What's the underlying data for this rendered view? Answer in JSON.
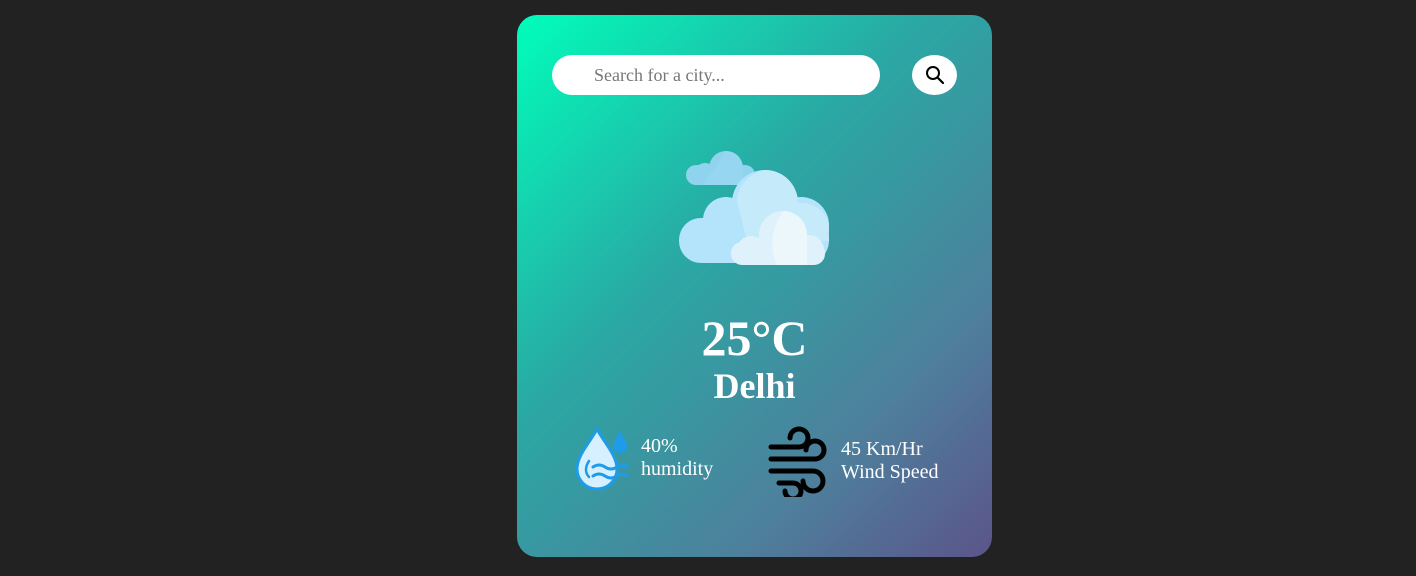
{
  "search": {
    "placeholder": "Search for a city...",
    "button_icon": "search-icon"
  },
  "weather": {
    "condition_icon": "clouds-icon",
    "temperature": "25°C",
    "city": "Delhi"
  },
  "details": {
    "humidity": {
      "icon": "humidity-icon",
      "value": "40%",
      "label": "humidity"
    },
    "wind": {
      "icon": "wind-icon",
      "value": "45 Km/Hr",
      "label": "Wind Speed"
    }
  },
  "colors": {
    "page_background": "#222222",
    "card_gradient_start": "#00feba",
    "card_gradient_end": "#5b548a",
    "text": "#ffffff"
  }
}
